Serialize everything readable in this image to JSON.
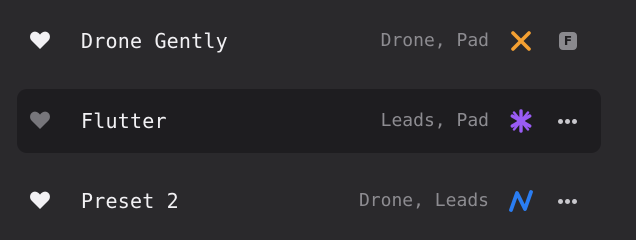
{
  "presets": [
    {
      "name": "Drone Gently",
      "tags": "Drone, Pad",
      "favorite": true,
      "favorite_color": "#f2f1f4",
      "icon": "orange-x-icon",
      "icon_color": "#f4a032",
      "action": "f-badge-icon",
      "action_label": "F",
      "selected": false
    },
    {
      "name": "Flutter",
      "tags": "Leads, Pad",
      "favorite": false,
      "favorite_color": "#77767b",
      "icon": "purple-asterisk-icon",
      "icon_color": "#9a5cf5",
      "action": "more-options-icon",
      "selected": true
    },
    {
      "name": "Preset 2",
      "tags": "Drone, Leads",
      "favorite": true,
      "favorite_color": "#f2f1f4",
      "icon": "blue-zigzag-icon",
      "icon_color": "#2a7df2",
      "action": "more-options-icon",
      "selected": false
    }
  ],
  "colors": {
    "background": "#2a292c",
    "selected_row": "#1e1d20",
    "name_text": "#f2f1f4",
    "tag_text": "#8d8c91"
  }
}
